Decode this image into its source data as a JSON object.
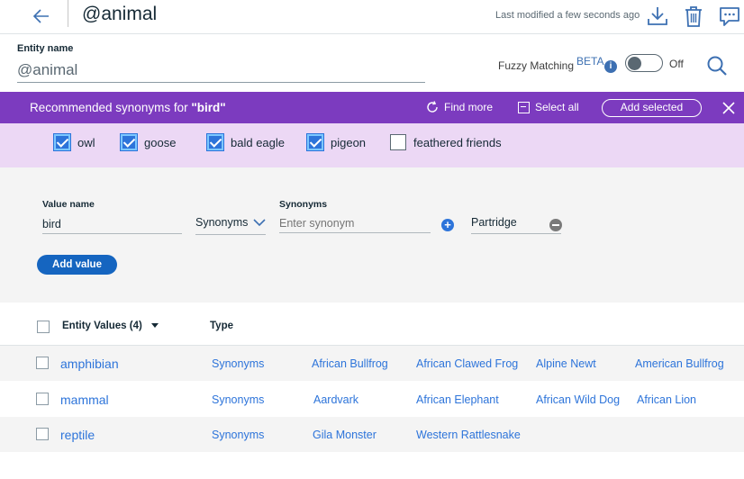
{
  "header": {
    "entity_title": "@animal",
    "last_modified": "Last modified a few seconds ago"
  },
  "entity_name": {
    "label": "Entity name",
    "value": "@animal"
  },
  "fuzzy": {
    "label": "Fuzzy Matching",
    "beta": "BETA",
    "info": "i",
    "state_text": "Off",
    "enabled": false
  },
  "banner": {
    "title_prefix": "Recommended synonyms for",
    "title_word": "\"bird\"",
    "find_more": "Find more",
    "select_all": "Select all",
    "add_selected": "Add selected"
  },
  "suggestions": [
    {
      "label": "owl",
      "checked": true
    },
    {
      "label": "goose",
      "checked": true
    },
    {
      "label": "bald eagle",
      "checked": true
    },
    {
      "label": "pigeon",
      "checked": true
    },
    {
      "label": "feathered friends",
      "checked": false
    }
  ],
  "form": {
    "value_name_label": "Value name",
    "value_name": "bird",
    "type_selected": "Synonyms",
    "synonyms_label": "Synonyms",
    "synonym_placeholder": "Enter synonym",
    "plus": "+",
    "existing_synonym": "Partridge",
    "add_value": "Add value"
  },
  "table": {
    "col_values": "Entity Values (4)",
    "col_type": "Type",
    "rows": [
      {
        "name": "amphibian",
        "type": "Synonyms",
        "values": [
          "African Bullfrog",
          "African Clawed Frog",
          "Alpine Newt",
          "American Bullfrog"
        ]
      },
      {
        "name": "mammal",
        "type": "Synonyms",
        "values": [
          "Aardvark",
          "African Elephant",
          "African Wild Dog",
          "African Lion"
        ]
      },
      {
        "name": "reptile",
        "type": "Synonyms",
        "values": [
          "Gila Monster",
          "Western Rattlesnake"
        ]
      }
    ]
  },
  "colors": {
    "accent_blue": "#2d74da",
    "banner_purple": "#7c3bbf",
    "suggestion_bg": "#ecd8f5"
  }
}
